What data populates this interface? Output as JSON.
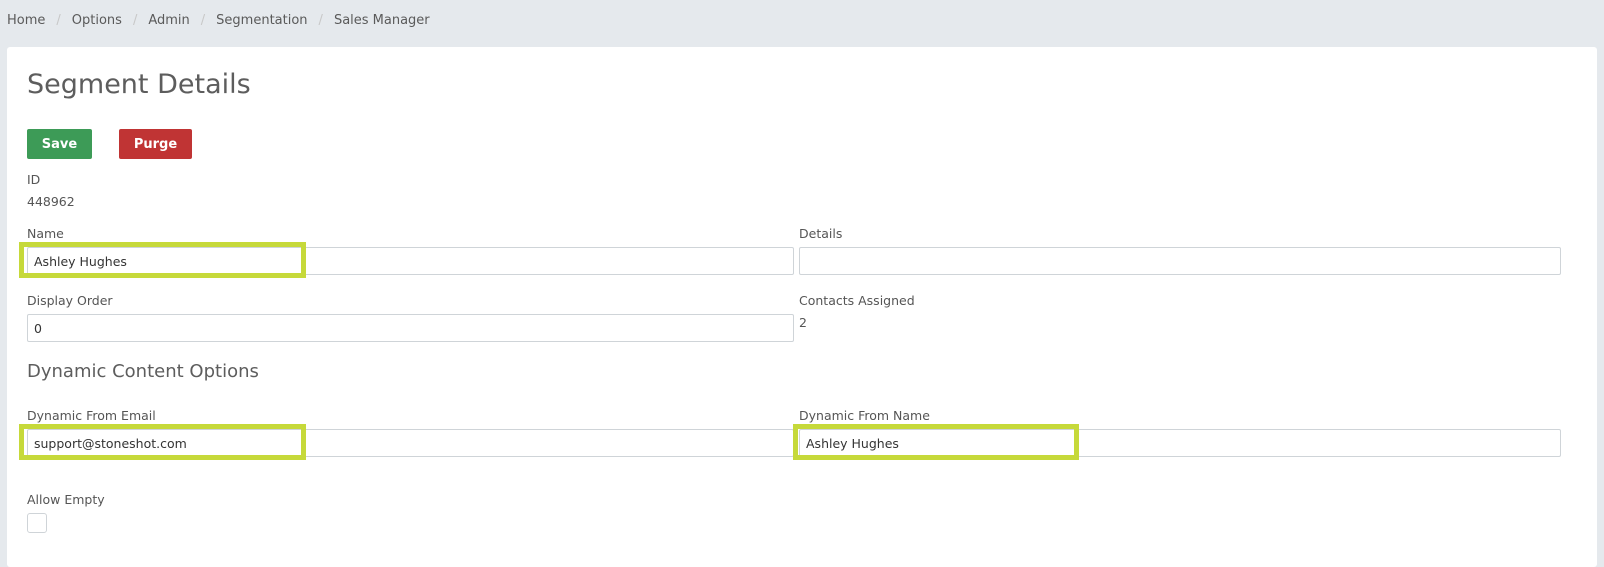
{
  "breadcrumb": [
    "Home",
    "Options",
    "Admin",
    "Segmentation",
    "Sales Manager"
  ],
  "page": {
    "title": "Segment Details",
    "save_label": "Save",
    "purge_label": "Purge"
  },
  "fields": {
    "id_label": "ID",
    "id_value": "448962",
    "name_label": "Name",
    "name_value": "Ashley Hughes",
    "details_label": "Details",
    "details_value": "",
    "display_order_label": "Display Order",
    "display_order_value": "0",
    "contacts_assigned_label": "Contacts Assigned",
    "contacts_assigned_value": "2"
  },
  "dynamic": {
    "section_title": "Dynamic Content Options",
    "from_email_label": "Dynamic From Email",
    "from_email_value": "support@stoneshot.com",
    "from_name_label": "Dynamic From Name",
    "from_name_value": "Ashley Hughes",
    "allow_empty_label": "Allow Empty"
  },
  "colors": {
    "save": "#3d9b57",
    "purge": "#c03434",
    "highlight": "#c6d93a",
    "page_bg": "#e5e9ed"
  }
}
